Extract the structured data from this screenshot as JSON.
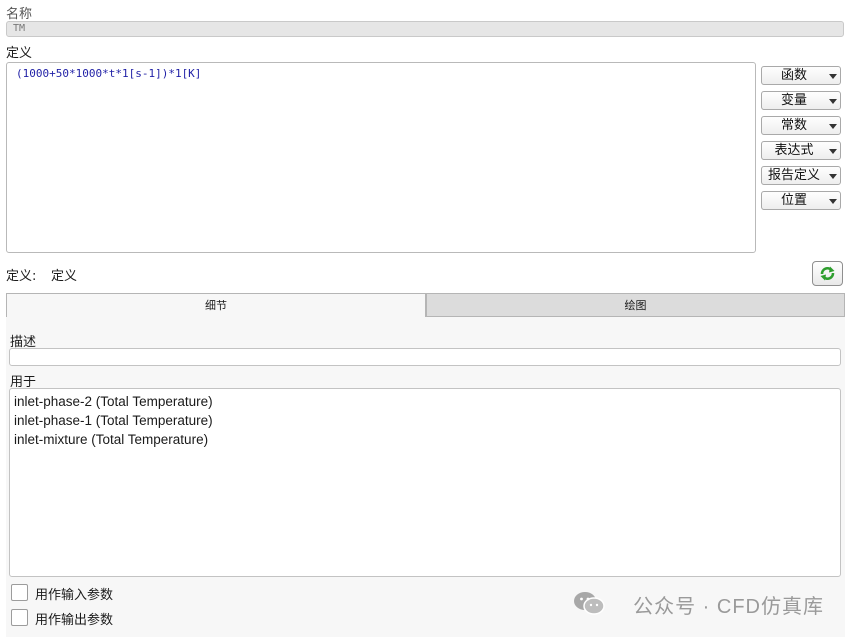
{
  "name_label": "名称",
  "name_value": "TM",
  "definition_label": "定义",
  "definition_value": "(1000+50*1000*t*1[s-1])*1[K]",
  "side_buttons": [
    {
      "label": "函数"
    },
    {
      "label": "变量"
    },
    {
      "label": "常数"
    },
    {
      "label": "表达式"
    },
    {
      "label": "报告定义"
    },
    {
      "label": "位置"
    }
  ],
  "definition_status_key": "定义:",
  "definition_status_value": "定义",
  "tabs": [
    {
      "label": "细节"
    },
    {
      "label": "绘图"
    }
  ],
  "details": {
    "description_label": "描述",
    "description_value": "",
    "used_in_label": "用于",
    "used_in_items": [
      "inlet-phase-2 (Total Temperature)",
      "inlet-phase-1 (Total Temperature)",
      "inlet-mixture (Total Temperature)"
    ],
    "checkbox_input_label": "用作输入参数",
    "checkbox_output_label": "用作输出参数"
  },
  "watermark": "公众号 · CFD仿真库",
  "colors": {
    "refresh_icon": "#2e9e2e",
    "definition_text": "#1f1fa6"
  }
}
